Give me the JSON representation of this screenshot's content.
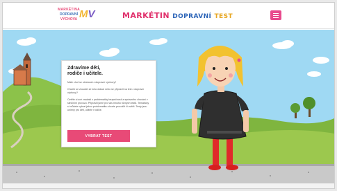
{
  "header": {
    "logo": {
      "line1": "MARKÉTINA",
      "line2": "DOPRAVNÍ",
      "line3": "VÝCHOVA",
      "mark_left": "M",
      "mark_right": "V"
    },
    "title": {
      "part1": "MARKÉTIN",
      "part2": "DOPRAVNÍ",
      "part3": "TEST"
    }
  },
  "card": {
    "heading_line1": "Zdravíme děti,",
    "heading_line2": "rodiče i učitele.",
    "subtitle": "Máte chuť se otestovat z dopravní výchovy?",
    "para1": "Chcete se zkoušet ze toho dokud nebo se připravit na test z dopravní výchovy?",
    "para2": "Ověřte si své znalosti z problematiky bezpečnosti a správného chování v silničním provozu. Připravili jsme pro vás mnoho různých testů. Tematicky si můžete vybrat jakou problematiku chcete procvičit či ověřit. Testy jsou určeny pro děti, učitele i rodiče.",
    "cta_label": "VYBRAT TEST"
  },
  "colors": {
    "accent": "#e84a77",
    "sky": "#9fd9f3",
    "grass": "#8cbf3f",
    "road": "#c8c8c8"
  }
}
